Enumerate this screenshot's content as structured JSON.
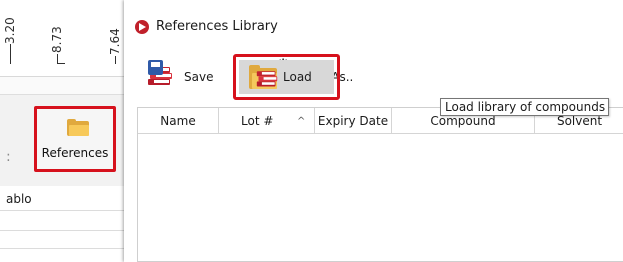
{
  "background_app": {
    "ruler_labels": [
      "3.20",
      "8.73",
      "7.64"
    ],
    "references_button_label": "References",
    "list_text": "ablo"
  },
  "dialog": {
    "title": "References Library",
    "toolbar": {
      "save_label": "Save",
      "save_as_label": "Save As..",
      "load_label": "Load"
    },
    "tooltip": "Load library of compounds",
    "table": {
      "columns": [
        "Name",
        "Lot #",
        "Expiry Date",
        "Compound",
        "Solvent"
      ],
      "sort_indicator": "^"
    }
  },
  "colors": {
    "highlight_red": "#d6111c",
    "folder_yellow": "#f4c85c",
    "book_red": "#c2242f",
    "pressed_button": "#d8d8d8"
  },
  "icons": [
    "app-logo-icon",
    "save-books-icon",
    "save-as-books-gear-icon",
    "open-folder-books-icon",
    "folder-icon",
    "sort-arrow-icon"
  ]
}
